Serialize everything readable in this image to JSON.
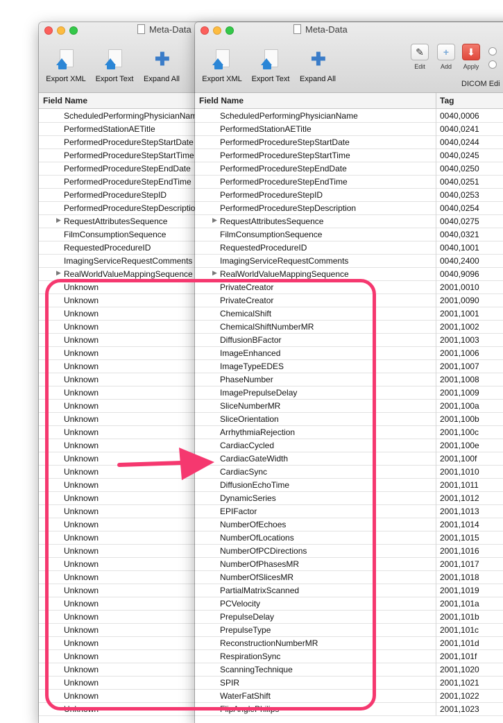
{
  "window": {
    "title": "Meta-Data"
  },
  "toolbar": {
    "export_xml": "Export XML",
    "export_text": "Export Text",
    "expand_all": "Expand All"
  },
  "right_toolbar": {
    "edit": "Edit",
    "add": "Add",
    "apply": "Apply",
    "dicom_label": "DICOM Edi"
  },
  "columns": {
    "field_name": "Field Name",
    "tag": "Tag"
  },
  "annotation_color": "#f5386f",
  "back_rows": [
    {
      "name": "ScheduledPerformingPhysicianName"
    },
    {
      "name": "PerformedStationAETitle"
    },
    {
      "name": "PerformedProcedureStepStartDate"
    },
    {
      "name": "PerformedProcedureStepStartTime"
    },
    {
      "name": "PerformedProcedureStepEndDate"
    },
    {
      "name": "PerformedProcedureStepEndTime"
    },
    {
      "name": "PerformedProcedureStepID"
    },
    {
      "name": "PerformedProcedureStepDescription"
    },
    {
      "name": "RequestAttributesSequence",
      "expand": true
    },
    {
      "name": "FilmConsumptionSequence"
    },
    {
      "name": "RequestedProcedureID"
    },
    {
      "name": "ImagingServiceRequestComments"
    },
    {
      "name": "RealWorldValueMappingSequence",
      "expand": true
    },
    {
      "name": "Unknown"
    },
    {
      "name": "Unknown"
    },
    {
      "name": "Unknown"
    },
    {
      "name": "Unknown"
    },
    {
      "name": "Unknown"
    },
    {
      "name": "Unknown"
    },
    {
      "name": "Unknown"
    },
    {
      "name": "Unknown"
    },
    {
      "name": "Unknown"
    },
    {
      "name": "Unknown"
    },
    {
      "name": "Unknown"
    },
    {
      "name": "Unknown"
    },
    {
      "name": "Unknown"
    },
    {
      "name": "Unknown"
    },
    {
      "name": "Unknown"
    },
    {
      "name": "Unknown"
    },
    {
      "name": "Unknown"
    },
    {
      "name": "Unknown"
    },
    {
      "name": "Unknown"
    },
    {
      "name": "Unknown"
    },
    {
      "name": "Unknown"
    },
    {
      "name": "Unknown"
    },
    {
      "name": "Unknown"
    },
    {
      "name": "Unknown"
    },
    {
      "name": "Unknown"
    },
    {
      "name": "Unknown"
    },
    {
      "name": "Unknown"
    },
    {
      "name": "Unknown"
    },
    {
      "name": "Unknown"
    },
    {
      "name": "Unknown"
    },
    {
      "name": "Unknown"
    },
    {
      "name": "Unknown"
    },
    {
      "name": "Unknown"
    }
  ],
  "front_rows": [
    {
      "name": "ScheduledPerformingPhysicianName",
      "tag": "0040,0006"
    },
    {
      "name": "PerformedStationAETitle",
      "tag": "0040,0241"
    },
    {
      "name": "PerformedProcedureStepStartDate",
      "tag": "0040,0244"
    },
    {
      "name": "PerformedProcedureStepStartTime",
      "tag": "0040,0245"
    },
    {
      "name": "PerformedProcedureStepEndDate",
      "tag": "0040,0250"
    },
    {
      "name": "PerformedProcedureStepEndTime",
      "tag": "0040,0251"
    },
    {
      "name": "PerformedProcedureStepID",
      "tag": "0040,0253"
    },
    {
      "name": "PerformedProcedureStepDescription",
      "tag": "0040,0254"
    },
    {
      "name": "RequestAttributesSequence",
      "tag": "0040,0275",
      "expand": true
    },
    {
      "name": "FilmConsumptionSequence",
      "tag": "0040,0321"
    },
    {
      "name": "RequestedProcedureID",
      "tag": "0040,1001"
    },
    {
      "name": "ImagingServiceRequestComments",
      "tag": "0040,2400"
    },
    {
      "name": "RealWorldValueMappingSequence",
      "tag": "0040,9096",
      "expand": true
    },
    {
      "name": "PrivateCreator",
      "tag": "2001,0010"
    },
    {
      "name": "PrivateCreator",
      "tag": "2001,0090"
    },
    {
      "name": "ChemicalShift",
      "tag": "2001,1001"
    },
    {
      "name": "ChemicalShiftNumberMR",
      "tag": "2001,1002"
    },
    {
      "name": "DiffusionBFactor",
      "tag": "2001,1003"
    },
    {
      "name": "ImageEnhanced",
      "tag": "2001,1006"
    },
    {
      "name": "ImageTypeEDES",
      "tag": "2001,1007"
    },
    {
      "name": "PhaseNumber",
      "tag": "2001,1008"
    },
    {
      "name": "ImagePrepulseDelay",
      "tag": "2001,1009"
    },
    {
      "name": "SliceNumberMR",
      "tag": "2001,100a"
    },
    {
      "name": "SliceOrientation",
      "tag": "2001,100b"
    },
    {
      "name": "ArrhythmiaRejection",
      "tag": "2001,100c"
    },
    {
      "name": "CardiacCycled",
      "tag": "2001,100e"
    },
    {
      "name": "CardiacGateWidth",
      "tag": "2001,100f"
    },
    {
      "name": "CardiacSync",
      "tag": "2001,1010"
    },
    {
      "name": "DiffusionEchoTime",
      "tag": "2001,1011"
    },
    {
      "name": "DynamicSeries",
      "tag": "2001,1012"
    },
    {
      "name": "EPIFactor",
      "tag": "2001,1013"
    },
    {
      "name": "NumberOfEchoes",
      "tag": "2001,1014"
    },
    {
      "name": "NumberOfLocations",
      "tag": "2001,1015"
    },
    {
      "name": "NumberOfPCDirections",
      "tag": "2001,1016"
    },
    {
      "name": "NumberOfPhasesMR",
      "tag": "2001,1017"
    },
    {
      "name": "NumberOfSlicesMR",
      "tag": "2001,1018"
    },
    {
      "name": "PartialMatrixScanned",
      "tag": "2001,1019"
    },
    {
      "name": "PCVelocity",
      "tag": "2001,101a"
    },
    {
      "name": "PrepulseDelay",
      "tag": "2001,101b"
    },
    {
      "name": "PrepulseType",
      "tag": "2001,101c"
    },
    {
      "name": "ReconstructionNumberMR",
      "tag": "2001,101d"
    },
    {
      "name": "RespirationSync",
      "tag": "2001,101f"
    },
    {
      "name": "ScanningTechnique",
      "tag": "2001,1020"
    },
    {
      "name": "SPIR",
      "tag": "2001,1021"
    },
    {
      "name": "WaterFatShift",
      "tag": "2001,1022"
    },
    {
      "name": "FlipAnglePhilips",
      "tag": "2001,1023"
    }
  ]
}
